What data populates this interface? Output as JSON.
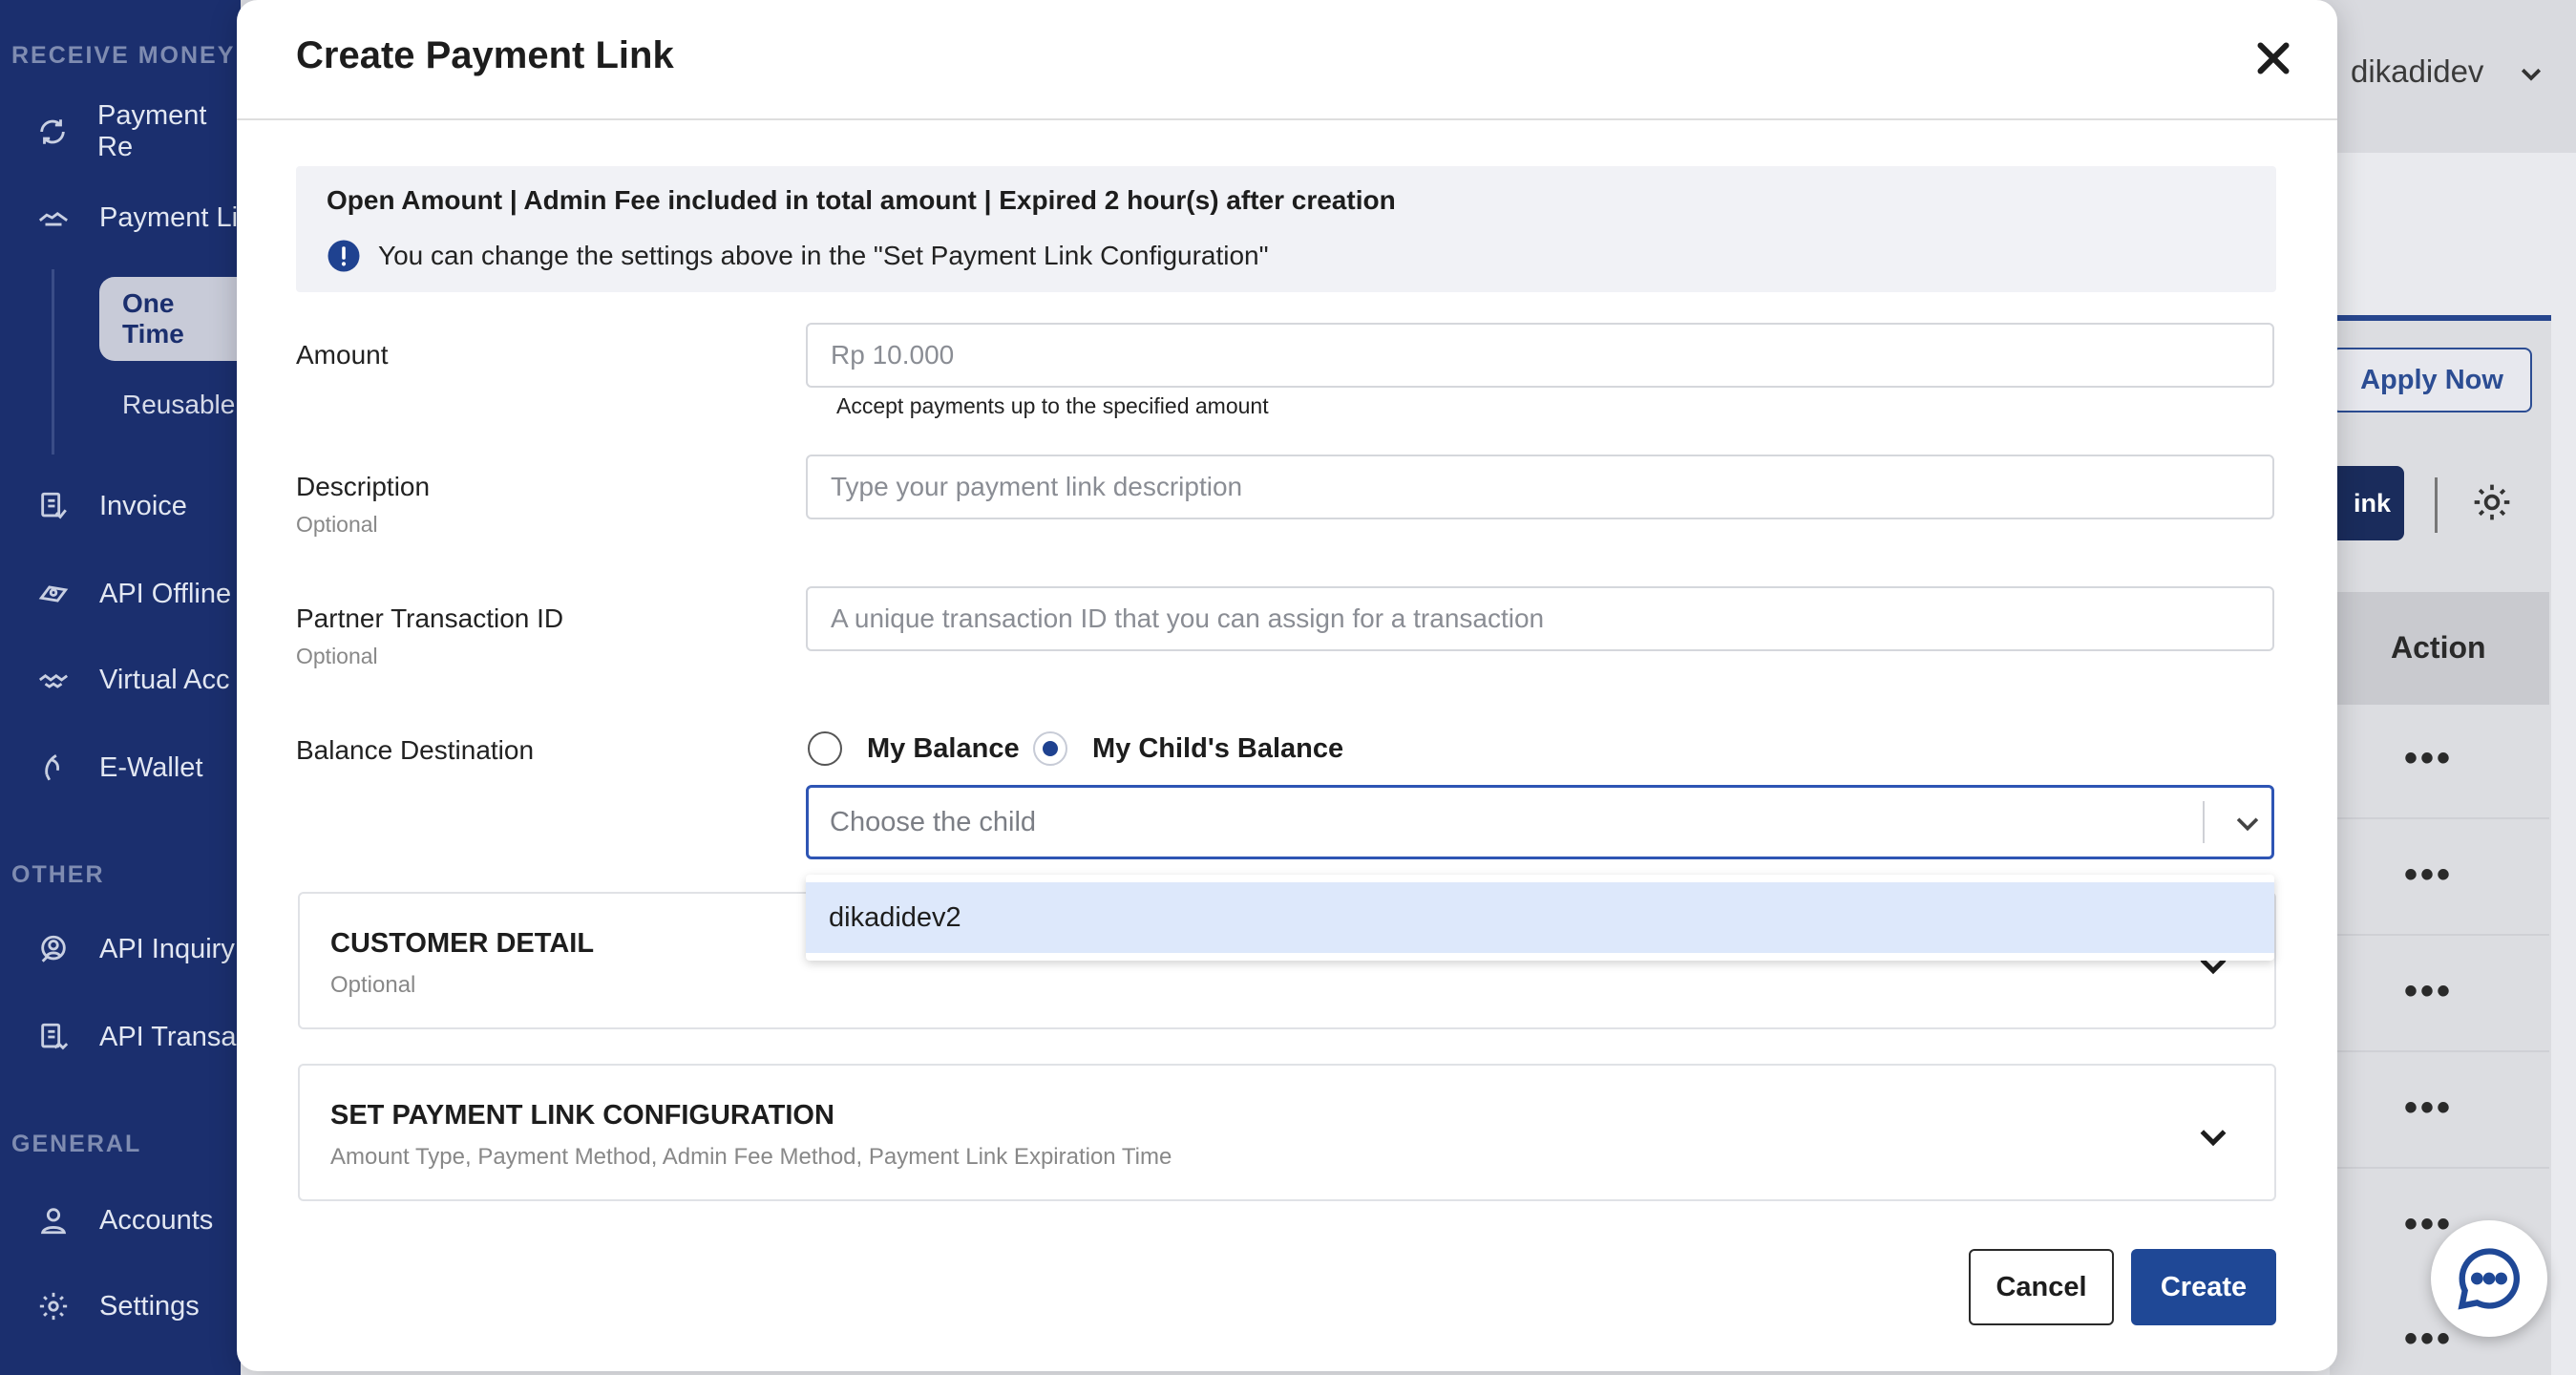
{
  "sidebar": {
    "sections": {
      "receive_money": "RECEIVE MONEY",
      "other": "OTHER",
      "general": "GENERAL"
    },
    "items": {
      "payment_request": "Payment Re",
      "payment_link": "Payment Li",
      "one_time": "One Time",
      "reusable": "Reusable",
      "invoice": "Invoice",
      "api_offline": "API Offline",
      "virtual_account": "Virtual Acc",
      "e_wallet": "E-Wallet",
      "api_inquiry": "API Inquiry",
      "api_transaction": "API Transa",
      "accounts": "Accounts",
      "settings": "Settings"
    }
  },
  "header": {
    "user_name": "dikadidev"
  },
  "background": {
    "apply_label": "Apply Now",
    "link_btn_label": "ink",
    "action_header": "Action",
    "row_menu": "•••"
  },
  "modal": {
    "title": "Create Payment Link",
    "info": {
      "summary": "Open Amount | Admin Fee included in total amount | Expired 2 hour(s) after creation",
      "hint": "You can change the settings above in the \"Set Payment Link Configuration\""
    },
    "amount": {
      "label": "Amount",
      "placeholder": "Rp 10.000",
      "helper": "Accept payments up to the specified amount"
    },
    "description": {
      "label": "Description",
      "optional": "Optional",
      "placeholder": "Type your payment link description"
    },
    "partner_txn": {
      "label": "Partner Transaction ID",
      "optional": "Optional",
      "placeholder": "A unique transaction ID that you can assign for a transaction"
    },
    "balance": {
      "label": "Balance Destination",
      "option_my": "My Balance",
      "option_child": "My Child's Balance",
      "selected": "My Child's Balance",
      "select_placeholder": "Choose the child",
      "dropdown_options": [
        "dikadidev2"
      ]
    },
    "customer_detail": {
      "title": "CUSTOMER DETAIL",
      "subtitle": "Optional"
    },
    "config": {
      "title": "SET PAYMENT LINK CONFIGURATION",
      "subtitle": "Amount Type, Payment Method, Admin Fee Method, Payment Link Expiration Time"
    },
    "cancel_label": "Cancel",
    "create_label": "Create"
  },
  "colors": {
    "sidebar": "#1b2f6e",
    "primary": "#1f4896",
    "focus": "#2e55b4",
    "highlight": "#dde8fb"
  }
}
